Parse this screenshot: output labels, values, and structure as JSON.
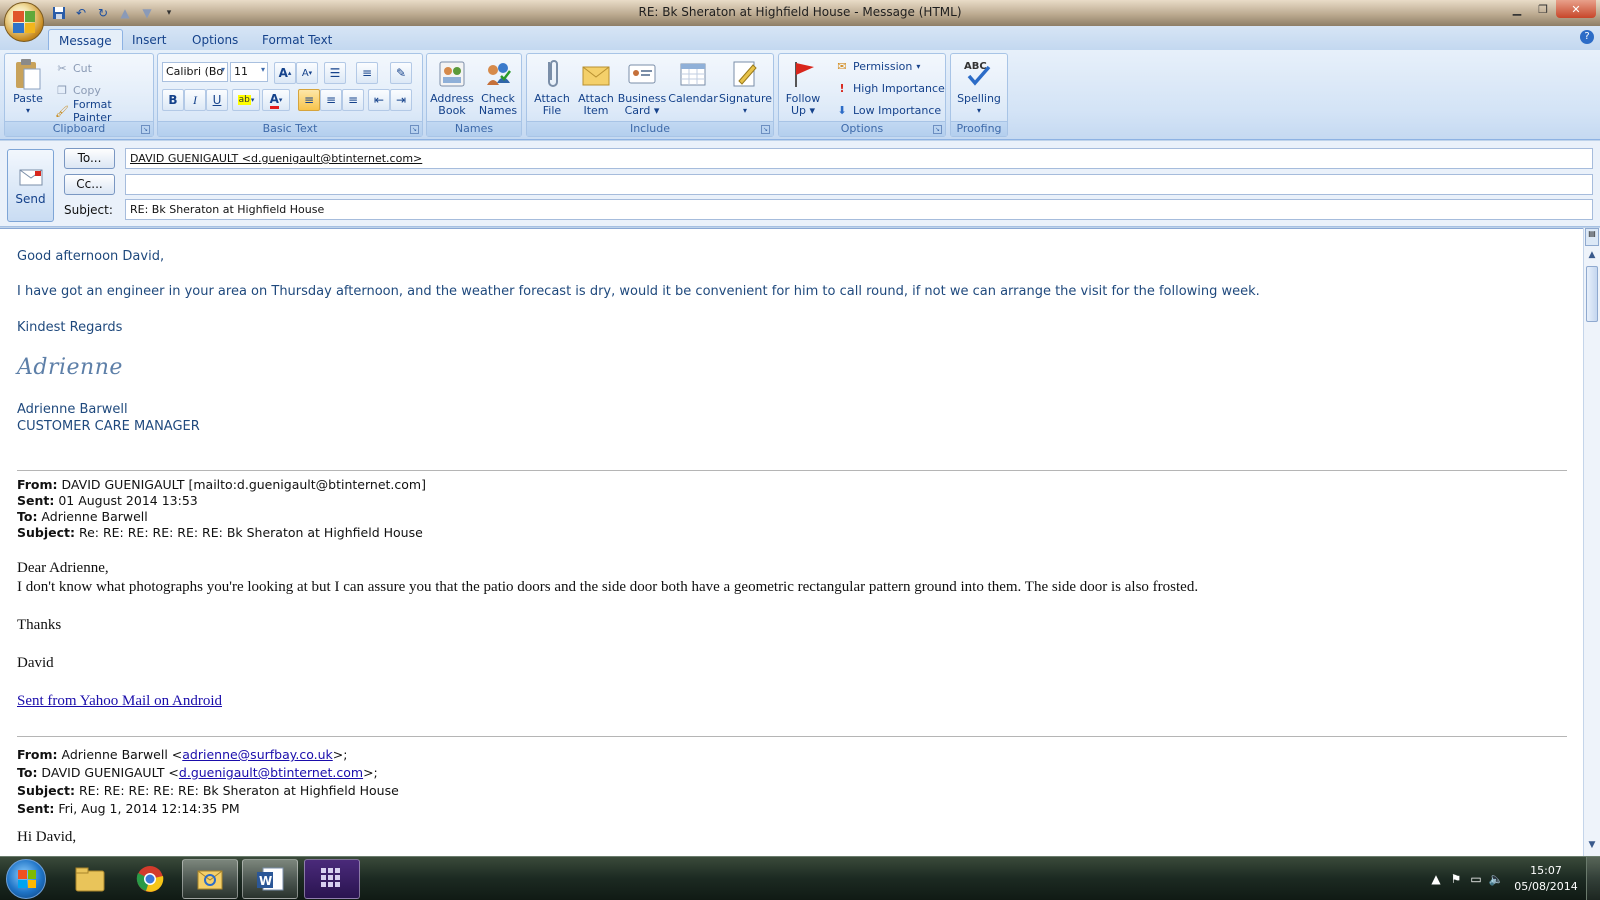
{
  "window": {
    "title": "RE: Bk Sheraton at Highfield House  -  Message (HTML)"
  },
  "tabs": [
    "Message",
    "Insert",
    "Options",
    "Format Text"
  ],
  "ribbon": {
    "clipboard": {
      "label": "Clipboard",
      "paste": "Paste",
      "cut": "Cut",
      "copy": "Copy",
      "format_painter": "Format Painter"
    },
    "basic_text": {
      "label": "Basic Text",
      "font_name": "Calibri (Bo",
      "font_size": "11"
    },
    "names": {
      "label": "Names",
      "address_book": [
        "Address",
        "Book"
      ],
      "check_names": [
        "Check",
        "Names"
      ]
    },
    "include": {
      "label": "Include",
      "attach_file": [
        "Attach",
        "File"
      ],
      "attach_item": [
        "Attach",
        "Item"
      ],
      "business_card": [
        "Business",
        "Card"
      ],
      "calendar": "Calendar",
      "signature": "Signature"
    },
    "options": {
      "label": "Options",
      "follow_up": [
        "Follow",
        "Up"
      ],
      "permission": "Permission",
      "high_importance": "High Importance",
      "low_importance": "Low Importance"
    },
    "proofing": {
      "label": "Proofing",
      "spelling": "Spelling",
      "abc": "ABC"
    }
  },
  "header": {
    "send": "Send",
    "to_button": "To...",
    "cc_button": "Cc...",
    "subject_label": "Subject:",
    "to_value": "DAVID GUENIGAULT <d.guenigault@btinternet.com>",
    "cc_value": "",
    "subject_value": "RE: Bk Sheraton at Highfield House"
  },
  "body": {
    "greeting": "Good afternoon David,",
    "para1": "I have got an engineer in your area on Thursday afternoon, and the weather forecast is dry, would it be convenient for him to call round, if not we can arrange the visit for the following week.",
    "closing": "Kindest Regards",
    "signature_script": "Adrienne",
    "sig_name": "Adrienne Barwell",
    "sig_title": "CUSTOMER CARE MANAGER",
    "quote1": {
      "from_label": "From:",
      "from_value": " DAVID GUENIGAULT [mailto:d.guenigault@btinternet.com]",
      "sent_label": "Sent:",
      "sent_value": " 01 August 2014 13:53",
      "to_label": "To:",
      "to_value": " Adrienne Barwell",
      "subject_label": "Subject:",
      "subject_value": " Re: RE: RE: RE: RE: RE: Bk Sheraton at Highfield House",
      "salutation": "Dear Adrienne,",
      "text": "I don't know what photographs you're looking at but I can assure you that the patio doors and the side door both have a geometric rectangular pattern ground into them. The side door is also frosted.",
      "thanks": "Thanks",
      "name": "David",
      "link": "Sent from Yahoo Mail on Android"
    },
    "quote2": {
      "from_label": "From:",
      "from_prefix": " Adrienne Barwell <",
      "from_email": "adrienne@surfbay.co.uk",
      "from_suffix": ">;",
      "to_label": "To:",
      "to_prefix": " DAVID GUENIGAULT <",
      "to_email": "d.guenigault@btinternet.com",
      "to_suffix": ">;",
      "subject_label": "Subject:",
      "subject_value": " RE: RE: RE: RE: RE: Bk Sheraton at Highfield House",
      "sent_label": "Sent:",
      "sent_value": " Fri, Aug 1, 2014 12:14:35 PM",
      "salutation": "Hi David,"
    }
  },
  "taskbar": {
    "time": "15:07",
    "date": "05/08/2014"
  },
  "colors": {
    "accent": "#15428b",
    "body_text": "#1f497d",
    "link": "#1a0dab"
  }
}
